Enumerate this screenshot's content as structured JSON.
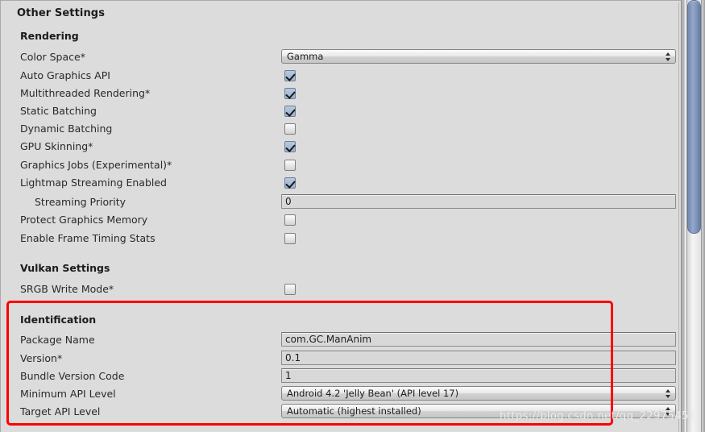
{
  "panel": {
    "section_title": "Other Settings",
    "groups": [
      {
        "name": "rendering",
        "title": "Rendering",
        "rows": [
          {
            "label": "Color Space*",
            "control": "dropdown",
            "value": "Gamma"
          },
          {
            "label": "Auto Graphics API",
            "control": "checkbox",
            "value": "checked"
          },
          {
            "label": "Multithreaded Rendering*",
            "control": "checkbox",
            "value": "checked"
          },
          {
            "label": "Static Batching",
            "control": "checkbox",
            "value": "checked"
          },
          {
            "label": "Dynamic Batching",
            "control": "checkbox",
            "value": "unchecked"
          },
          {
            "label": "GPU Skinning*",
            "control": "checkbox",
            "value": "checked"
          },
          {
            "label": "Graphics Jobs (Experimental)*",
            "control": "checkbox",
            "value": "unchecked"
          },
          {
            "label": "Lightmap Streaming Enabled",
            "control": "checkbox",
            "value": "checked"
          },
          {
            "label": "Streaming Priority",
            "control": "textfield",
            "value": "0",
            "indent": true
          },
          {
            "label": "Protect Graphics Memory",
            "control": "checkbox",
            "value": "unchecked"
          },
          {
            "label": "Enable Frame Timing Stats",
            "control": "checkbox",
            "value": "unchecked"
          }
        ]
      },
      {
        "name": "vulkan-settings",
        "title": "Vulkan Settings",
        "rows": [
          {
            "label": "SRGB Write Mode*",
            "control": "checkbox",
            "value": "unchecked"
          }
        ]
      },
      {
        "name": "identification",
        "title": "Identification",
        "rows": [
          {
            "label": "Package Name",
            "control": "textfield",
            "value": "com.GC.ManAnim"
          },
          {
            "label": "Version*",
            "control": "textfield",
            "value": "0.1"
          },
          {
            "label": "Bundle Version Code",
            "control": "textfield",
            "value": "1"
          },
          {
            "label": "Minimum API Level",
            "control": "dropdown",
            "value": "Android 4.2 'Jelly Bean' (API level 17)"
          },
          {
            "label": "Target API Level",
            "control": "dropdown",
            "value": "Automatic (highest installed)"
          }
        ]
      }
    ]
  },
  "annotation": {
    "highlight_color": "#fe0000",
    "target_group": "identification"
  },
  "watermark": {
    "text": "https://blog.csdn.net/qq_22975451"
  },
  "scrollbar": {
    "orientation": "vertical",
    "thumb_position": "top"
  }
}
